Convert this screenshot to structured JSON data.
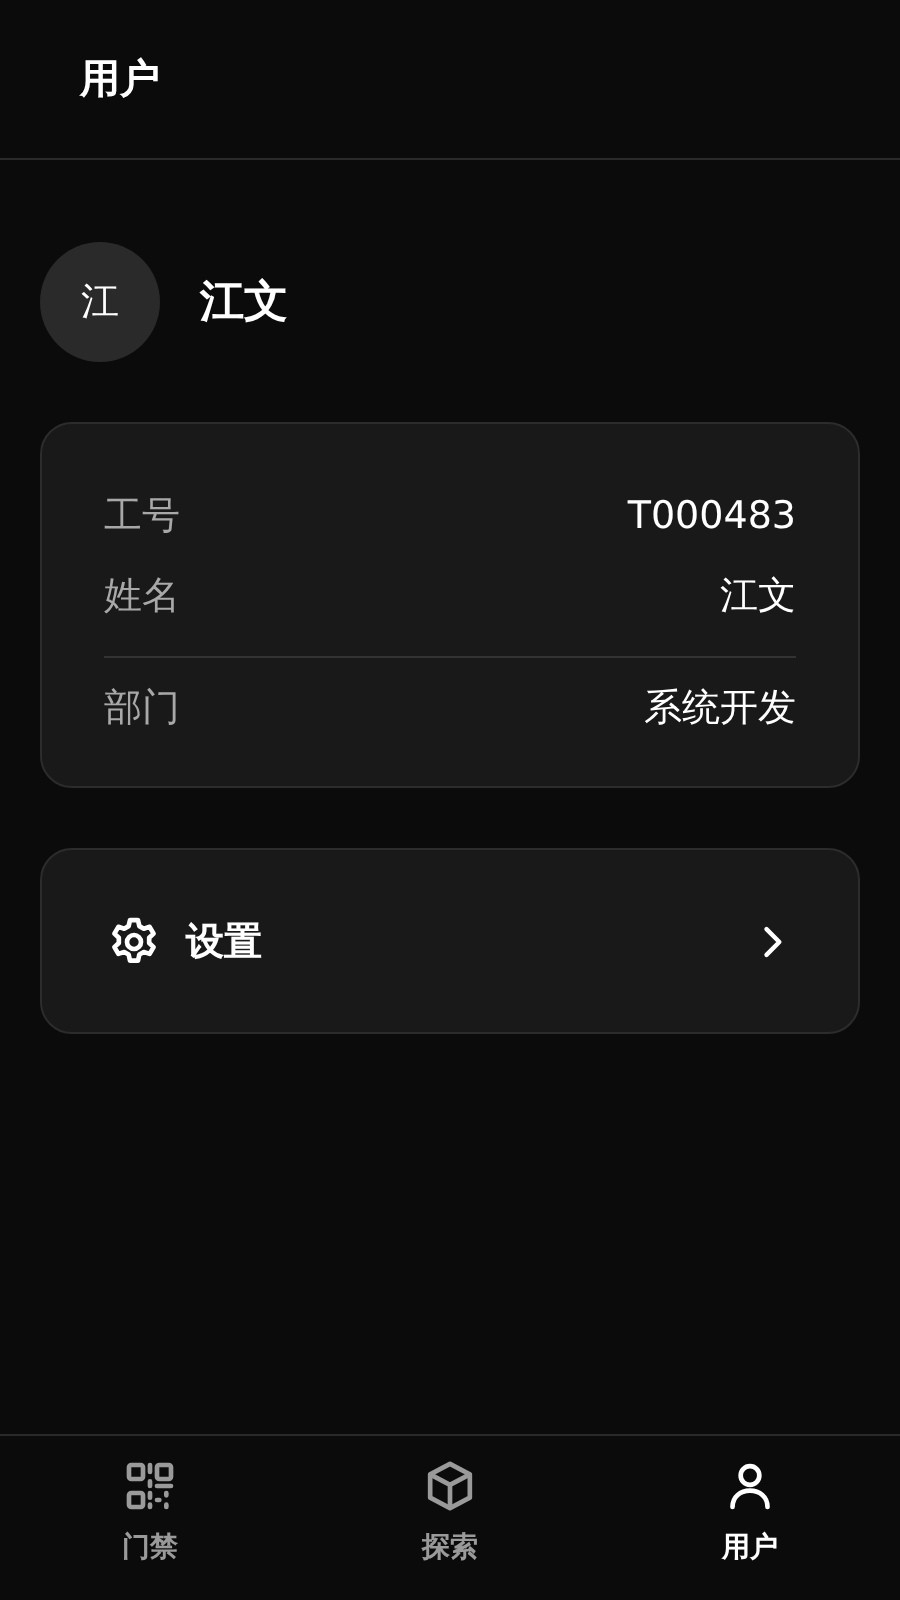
{
  "header": {
    "title": "用户"
  },
  "profile": {
    "avatar": "江",
    "name": "江文"
  },
  "info_sections": [
    [
      {
        "label": "工号",
        "value": "T000483"
      },
      {
        "label": "姓名",
        "value": "江文"
      }
    ],
    [
      {
        "label": "部门",
        "value": "系统开发"
      }
    ]
  ],
  "settings": {
    "label": "设置"
  },
  "tabs": [
    {
      "kind": "qr",
      "label": "门禁",
      "selected": false
    },
    {
      "kind": "box",
      "label": "探索",
      "selected": false
    },
    {
      "kind": "person",
      "label": "用户",
      "selected": true
    }
  ]
}
